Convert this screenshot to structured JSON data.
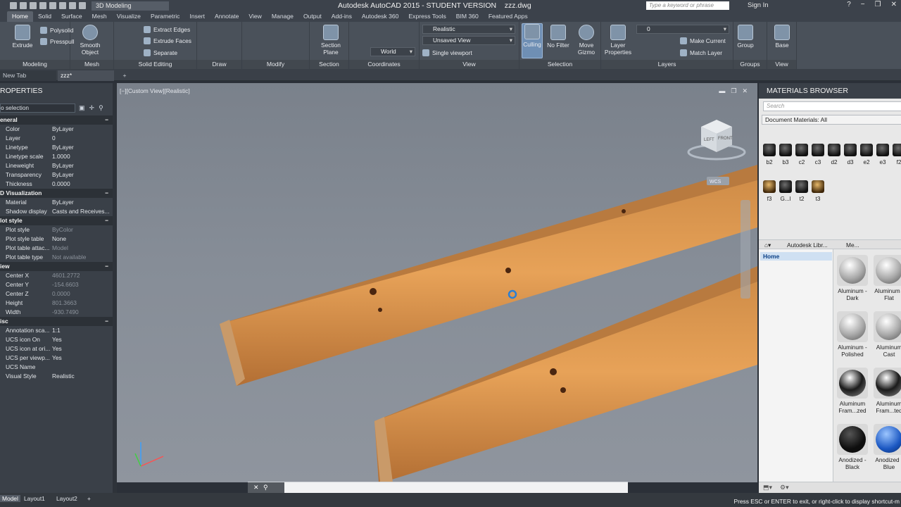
{
  "title": {
    "app_title": "Autodesk AutoCAD 2015 - STUDENT VERSION",
    "doc_name": "zzz.dwg",
    "workspace": "3D Modeling",
    "search_placeholder": "Type a keyword or phrase",
    "sign_in": "Sign In"
  },
  "ribbon_tabs": [
    "Home",
    "Solid",
    "Surface",
    "Mesh",
    "Visualize",
    "Parametric",
    "Insert",
    "Annotate",
    "View",
    "Manage",
    "Output",
    "Add-ins",
    "Autodesk 360",
    "Express Tools",
    "BIM 360",
    "Featured Apps"
  ],
  "ribbon": {
    "extrude": "Extrude",
    "polysolid": "Polysolid",
    "presspull": "Presspull",
    "smooth_object": "Smooth Object",
    "extract_edges": "Extract Edges",
    "extrude_faces": "Extrude Faces",
    "separate": "Separate",
    "section_plane": "Section Plane",
    "visual_style": "Realistic",
    "named_view": "Unsaved View",
    "ucs": "World",
    "viewport": "Single viewport",
    "culling": "Culling",
    "no_filter": "No Filter",
    "move_gizmo": "Move Gizmo",
    "layer_properties": "Layer Properties",
    "layer_current": "0",
    "make_current": "Make Current",
    "match_layer": "Match Layer",
    "group": "Group",
    "base": "Base",
    "panels": {
      "modeling": "Modeling",
      "mesh": "Mesh",
      "solid_editing": "Solid Editing",
      "draw": "Draw",
      "modify": "Modify",
      "section": "Section",
      "coordinates": "Coordinates",
      "view": "View",
      "selection": "Selection",
      "layers": "Layers",
      "groups": "Groups",
      "view2": "View"
    }
  },
  "doc_tabs": [
    "New Tab",
    "zzz*"
  ],
  "properties": {
    "header": "ROPERTIES",
    "selection": "o selection",
    "sections": [
      {
        "name": "eneral",
        "rows": [
          [
            "Color",
            "ByLayer"
          ],
          [
            "Layer",
            "0"
          ],
          [
            "Linetype",
            "ByLayer"
          ],
          [
            "Linetype scale",
            "1.0000"
          ],
          [
            "Lineweight",
            "ByLayer"
          ],
          [
            "Transparency",
            "ByLayer"
          ],
          [
            "Thickness",
            "0.0000"
          ]
        ]
      },
      {
        "name": "D Visualization",
        "rows": [
          [
            "Material",
            "ByLayer"
          ],
          [
            "Shadow display",
            "Casts and Receives..."
          ]
        ]
      },
      {
        "name": "lot style",
        "rows": [
          [
            "Plot style",
            "ByColor"
          ],
          [
            "Plot style table",
            "None"
          ],
          [
            "Plot table attac...",
            "Model"
          ],
          [
            "Plot table type",
            "Not available"
          ]
        ]
      },
      {
        "name": "iew",
        "rows": [
          [
            "Center X",
            "4601.2772"
          ],
          [
            "Center Y",
            "-154.6603"
          ],
          [
            "Center Z",
            "0.0000"
          ],
          [
            "Height",
            "801.3663"
          ],
          [
            "Width",
            "-930.7490"
          ]
        ]
      },
      {
        "name": "isc",
        "rows": [
          [
            "Annotation sca...",
            "1:1"
          ],
          [
            "UCS icon On",
            "Yes"
          ],
          [
            "UCS icon at ori...",
            "Yes"
          ],
          [
            "UCS per viewp...",
            "Yes"
          ],
          [
            "UCS Name",
            ""
          ],
          [
            "Visual Style",
            "Realistic"
          ]
        ]
      }
    ]
  },
  "viewport": {
    "label": "[−][Custom View][Realistic]",
    "viewcube_left": "LEFT",
    "viewcube_front": "FRONT",
    "wcs": "WCS"
  },
  "materials": {
    "header": "MATERIALS BROWSER",
    "search_placeholder": "Search",
    "doc_materials": "Document Materials: All",
    "doc_items": [
      "b2",
      "b3",
      "c2",
      "c3",
      "d2",
      "d3",
      "e2",
      "e3",
      "f2",
      "f3",
      "G...l",
      "t2",
      "t3"
    ],
    "lib_dropdown": "Autodesk Libr...",
    "lib_dropdown2": "Me...",
    "home": "Home",
    "library": [
      {
        "name": "Aluminum - Dark",
        "kind": "plain"
      },
      {
        "name": "Aluminum - Flat",
        "kind": "plain"
      },
      {
        "name": "Aluminum - Polished",
        "kind": "plain"
      },
      {
        "name": "Aluminum Cast",
        "kind": "plain"
      },
      {
        "name": "Aluminum Fram...zed",
        "kind": "chrome"
      },
      {
        "name": "Aluminum Fram...ted",
        "kind": "chrome"
      },
      {
        "name": "Anodized - Black",
        "kind": "black"
      },
      {
        "name": "Anodized - Blue",
        "kind": "blue"
      }
    ]
  },
  "layouts": [
    "Model",
    "Layout1",
    "Layout2"
  ],
  "status_message": "Press ESC or ENTER to exit, or right-click to display shortcut-m"
}
